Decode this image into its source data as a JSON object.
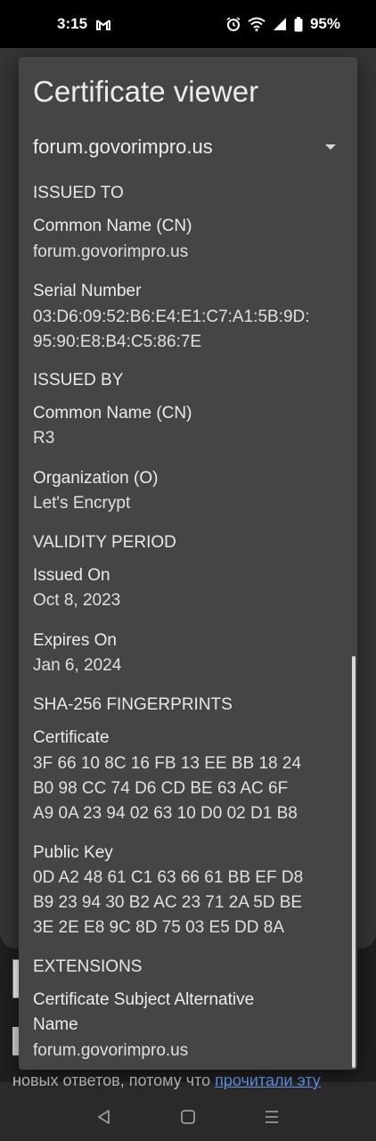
{
  "status_bar": {
    "time": "3:15",
    "battery": "95%",
    "icons": [
      "gmail-icon",
      "alarm-icon",
      "wifi-icon",
      "signal-icon",
      "battery-icon"
    ]
  },
  "background_page": {
    "text_before_link": "новых ответов, потому что ",
    "link_text": "прочитали эту"
  },
  "dialog": {
    "title": "Certificate viewer",
    "selected_host": "forum.govorimpro.us",
    "issued_to": {
      "heading": "ISSUED TO",
      "cn_label": "Common Name (CN)",
      "cn_value": "forum.govorimpro.us",
      "serial_label": "Serial Number",
      "serial_line1": "03:D6:09:52:B6:E4:E1:C7:A1:5B:9D:",
      "serial_line2": "95:90:E8:B4:C5:86:7E"
    },
    "issued_by": {
      "heading": "ISSUED BY",
      "cn_label": "Common Name (CN)",
      "cn_value": "R3",
      "org_label": "Organization (O)",
      "org_value": "Let's Encrypt"
    },
    "validity": {
      "heading": "VALIDITY PERIOD",
      "issued_label": "Issued On",
      "issued_value": "Oct 8, 2023",
      "expires_label": "Expires On",
      "expires_value": "Jan 6, 2024"
    },
    "fingerprints": {
      "heading": "SHA-256 FINGERPRINTS",
      "cert_label": "Certificate",
      "cert_line1": "3F 66 10 8C 16 FB 13 EE BB 18 24",
      "cert_line2": "B0 98 CC 74 D6 CD BE 63 AC 6F",
      "cert_line3": "A9 0A 23 94 02 63 10 D0 02 D1 B8",
      "pubkey_label": "Public Key",
      "pubkey_line1": "0D A2 48 61 C1 63 66 61 BB EF D8",
      "pubkey_line2": "B9 23 94 30 B2 AC 23 71 2A 5D BE",
      "pubkey_line3": "3E 2E E8 9C 8D 75 03 E5 DD 8A"
    },
    "extensions": {
      "heading": "EXTENSIONS",
      "san_label_line1": "Certificate Subject Alternative",
      "san_label_line2": "Name",
      "san_value": "forum.govorimpro.us"
    }
  },
  "nav_bar": {
    "buttons": [
      "back-icon",
      "home-icon",
      "recents-icon"
    ]
  }
}
